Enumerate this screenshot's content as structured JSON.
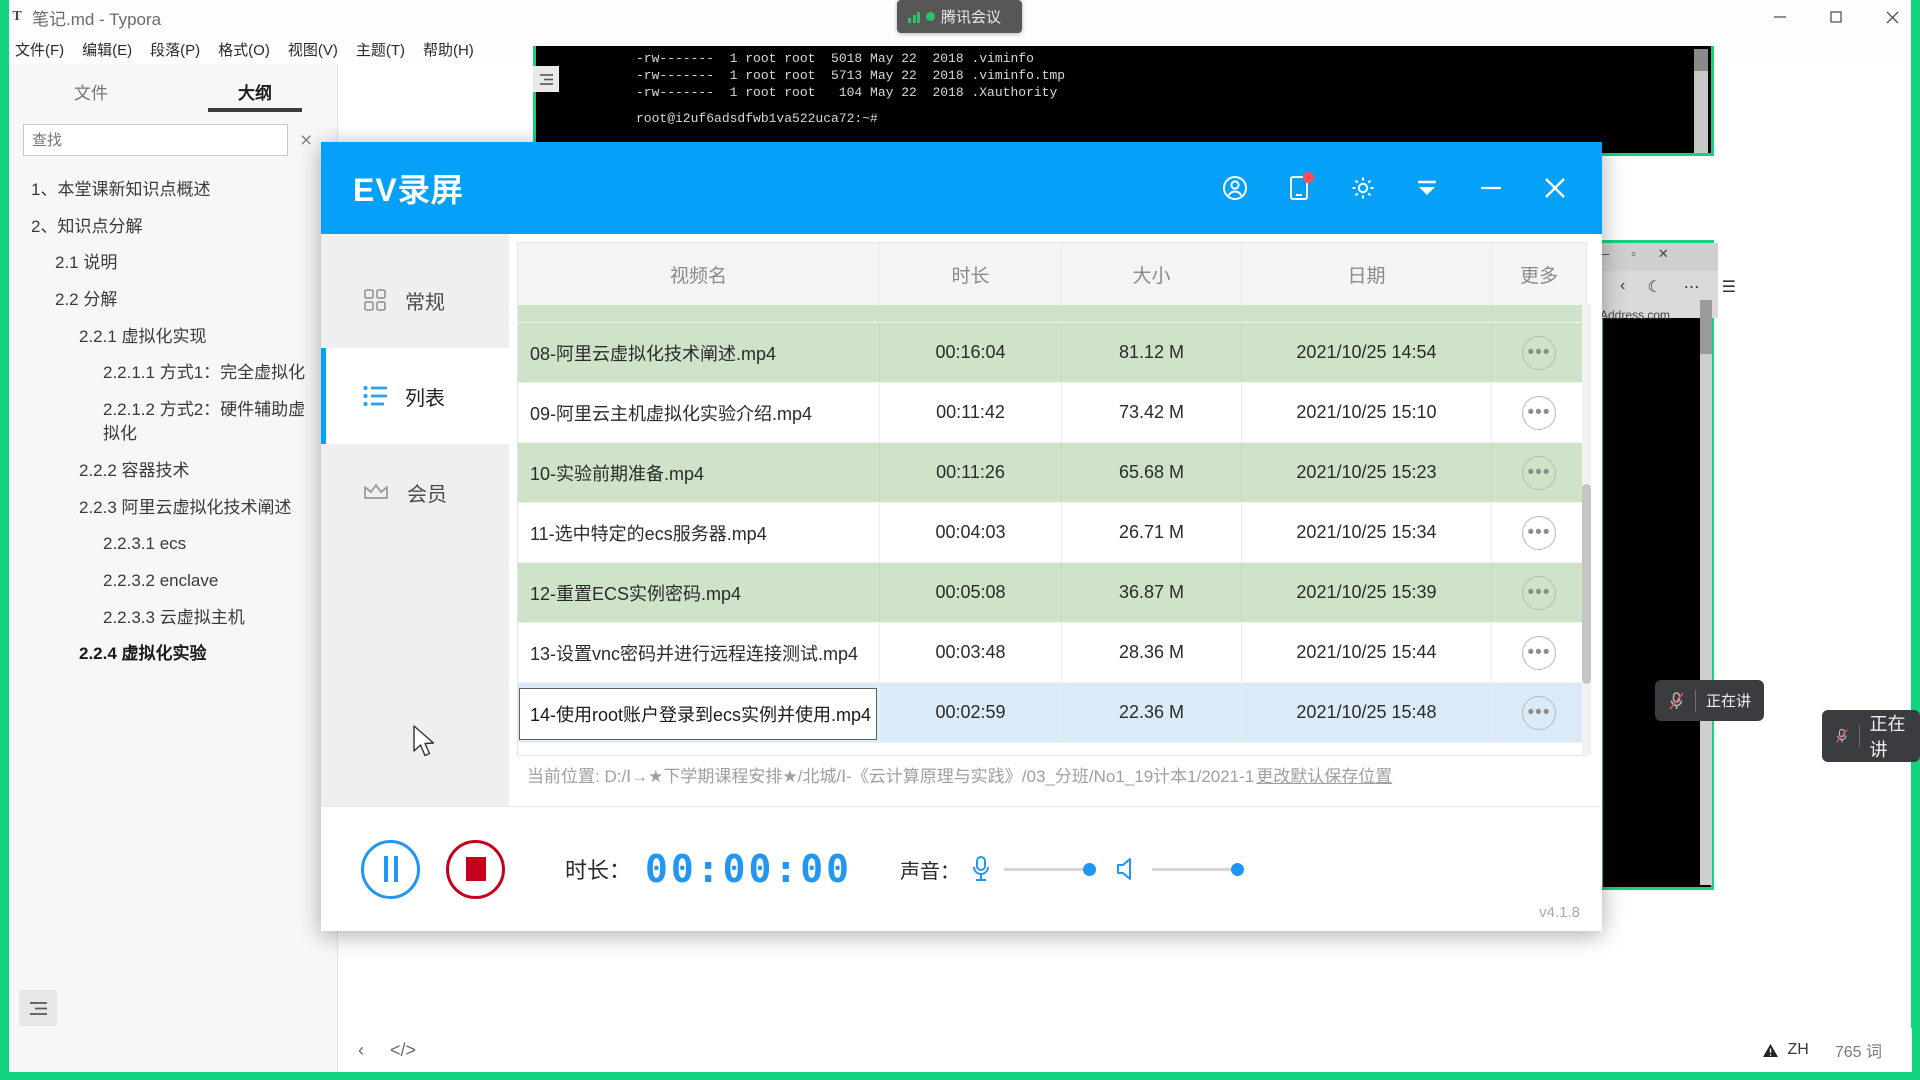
{
  "typora": {
    "title": "笔记.md - Typora",
    "logo": "T",
    "menus": [
      "文件(F)",
      "编辑(E)",
      "段落(P)",
      "格式(O)",
      "视图(V)",
      "主题(T)",
      "帮助(H)"
    ],
    "window_controls": [
      "minimize-button",
      "maximize-button",
      "close-button"
    ],
    "sidebar": {
      "tabs": [
        {
          "label": "文件",
          "active": false
        },
        {
          "label": "大纲",
          "active": true
        }
      ],
      "search_placeholder": "查找",
      "search_value": "",
      "outline": [
        {
          "label": "1、本堂课新知识点概述",
          "level": 1,
          "bold": false
        },
        {
          "label": "2、知识点分解",
          "level": 1,
          "bold": false
        },
        {
          "label": "2.1 说明",
          "level": 2,
          "bold": false
        },
        {
          "label": "2.2 分解",
          "level": 2,
          "bold": false
        },
        {
          "label": "2.2.1 虚拟化实现",
          "level": 3,
          "bold": false
        },
        {
          "label": "2.2.1.1 方式1：完全虚拟化",
          "level": 4,
          "bold": false
        },
        {
          "label": "2.2.1.2 方式2：硬件辅助虚拟化",
          "level": 4,
          "bold": false
        },
        {
          "label": "2.2.2 容器技术",
          "level": 3,
          "bold": false
        },
        {
          "label": "2.2.3 阿里云虚拟化技术阐述",
          "level": 3,
          "bold": false
        },
        {
          "label": "2.2.3.1 ecs",
          "level": 4,
          "bold": false
        },
        {
          "label": "2.2.3.2 enclave",
          "level": 4,
          "bold": false
        },
        {
          "label": "2.2.3.3 云虚拟主机",
          "level": 4,
          "bold": false
        },
        {
          "label": "2.2.4 虚拟化实验",
          "level": 3,
          "bold": true
        }
      ]
    },
    "footer": {
      "prev_label": "‹",
      "source_label": "</>",
      "lang": "ZH",
      "word_count": "765 词"
    }
  },
  "tencent_meeting": {
    "label": "腾讯会议"
  },
  "terminal": {
    "lines": [
      "-rw-------  1 root root  5018 May 22  2018 .viminfo",
      "-rw-------  1 root root  5713 May 22  2018 .viminfo.tmp",
      "-rw-------  1 root root   104 May 22  2018 .Xauthority",
      "root@i2uf6adsdfwb1va522uca72:~#"
    ]
  },
  "browser": {
    "url_text": "Address.com"
  },
  "mic_pills": [
    {
      "label": "正在讲"
    },
    {
      "label": "正在讲"
    }
  ],
  "ev": {
    "title": "EV录屏",
    "version": "v4.1.8",
    "titlebar_icons": [
      {
        "name": "user-account-icon"
      },
      {
        "name": "mobile-device-icon",
        "badge": true
      },
      {
        "name": "settings-gear-icon"
      },
      {
        "name": "collapse-icon"
      },
      {
        "name": "minimize-icon"
      },
      {
        "name": "close-icon"
      }
    ],
    "nav": [
      {
        "label": "常规",
        "icon": "grid-icon",
        "active": false
      },
      {
        "label": "列表",
        "icon": "list-icon",
        "active": true
      },
      {
        "label": "会员",
        "icon": "crown-icon",
        "active": false
      }
    ],
    "table": {
      "headers": [
        "视频名",
        "时长",
        "大小",
        "日期",
        "更多"
      ],
      "rows": [
        {
          "name": "08-阿里云虚拟化技术阐述.mp4",
          "duration": "00:16:04",
          "size": "81.12 M",
          "date": "2021/10/25 14:54",
          "style": "green",
          "editing": false
        },
        {
          "name": "09-阿里云主机虚拟化实验介绍.mp4",
          "duration": "00:11:42",
          "size": "73.42 M",
          "date": "2021/10/25 15:10",
          "style": "white",
          "editing": false
        },
        {
          "name": "10-实验前期准备.mp4",
          "duration": "00:11:26",
          "size": "65.68 M",
          "date": "2021/10/25 15:23",
          "style": "green",
          "editing": false
        },
        {
          "name": "11-选中特定的ecs服务器.mp4",
          "duration": "00:04:03",
          "size": "26.71 M",
          "date": "2021/10/25 15:34",
          "style": "white",
          "editing": false
        },
        {
          "name": "12-重置ECS实例密码.mp4",
          "duration": "00:05:08",
          "size": "36.87 M",
          "date": "2021/10/25 15:39",
          "style": "green",
          "editing": false
        },
        {
          "name": "13-设置vnc密码并进行远程连接测试.mp4",
          "duration": "00:03:48",
          "size": "28.36 M",
          "date": "2021/10/25 15:44",
          "style": "white",
          "editing": false
        },
        {
          "name": "14-使用root账户登录到ecs实例并使用.mp4",
          "duration": "00:02:59",
          "size": "22.36 M",
          "date": "2021/10/25 15:48",
          "style": "selected",
          "editing": true
        }
      ],
      "more_button_glyph": "•••"
    },
    "path": {
      "prefix": "当前位置: D:/Ⅰ→★下学期课程安排★/北城/Ⅰ-《云计算原理与实践》/03_分班/No1_19计本1/2021-1",
      "link": "更改默认保存位置"
    },
    "controls": {
      "pause_name": "pause-button",
      "stop_name": "stop-button",
      "duration_label": "时长：",
      "duration_value": "00:00:00",
      "volume_label": "声音：",
      "mic_icon": "microphone-icon",
      "speaker_icon": "speaker-icon"
    },
    "accent_color": "#05a0f8",
    "row_green": "#cfe3c8",
    "row_selected": "#dbeaf7"
  }
}
